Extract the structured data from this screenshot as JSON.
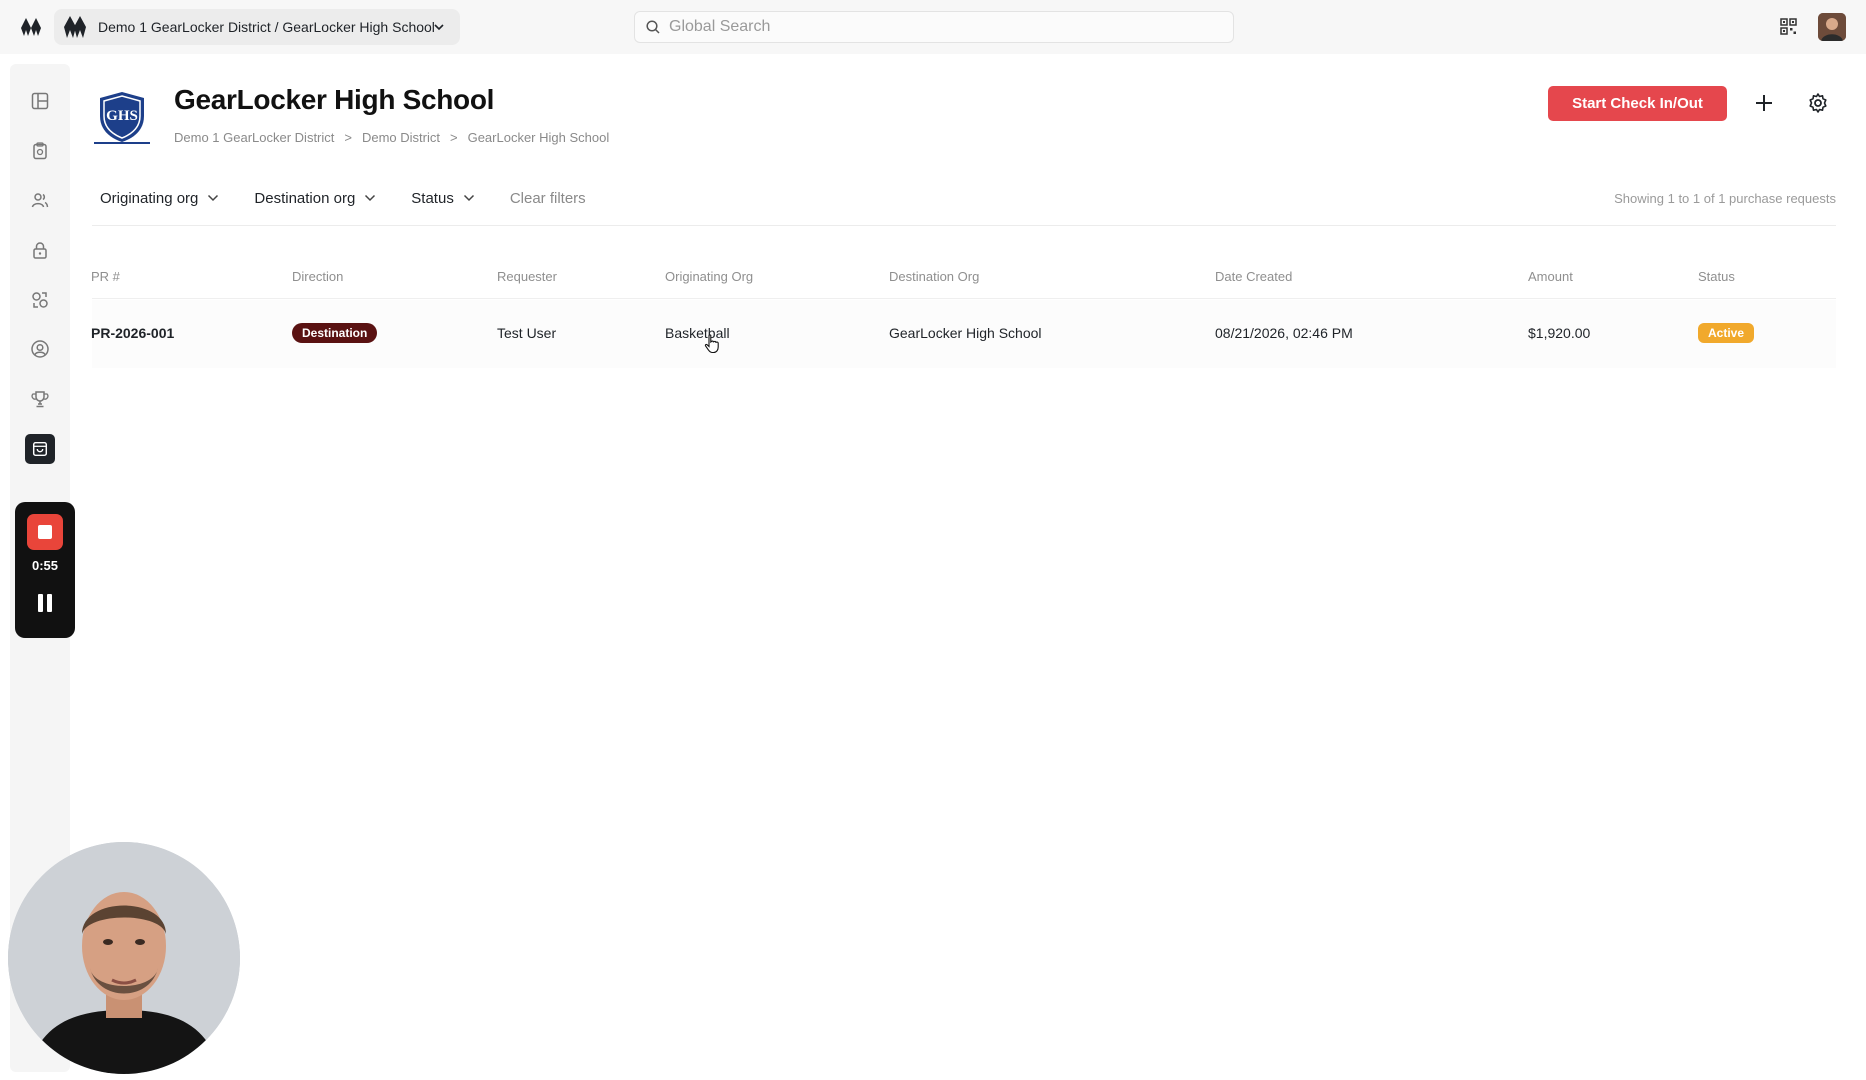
{
  "topbar": {
    "org_switcher_label": "Demo 1 GearLocker District / GearLocker High School",
    "search_placeholder": "Global Search"
  },
  "sidebar": {
    "items": [
      {
        "name": "dashboard-icon"
      },
      {
        "name": "clipboard-icon"
      },
      {
        "name": "users-icon"
      },
      {
        "name": "lock-icon"
      },
      {
        "name": "exchange-icon"
      },
      {
        "name": "user-circle-icon"
      },
      {
        "name": "trophy-icon"
      },
      {
        "name": "shopping-bag-icon",
        "active": true
      }
    ]
  },
  "recorder": {
    "time": "0:55"
  },
  "header": {
    "title": "GearLocker High School",
    "breadcrumb": [
      "Demo 1 GearLocker District",
      ">",
      "Demo District",
      ">",
      "GearLocker High School"
    ],
    "start_button": "Start Check In/Out"
  },
  "filters": {
    "items": [
      "Originating org",
      "Destination org",
      "Status"
    ],
    "clear": "Clear filters",
    "showing": "Showing 1 to 1 of 1 purchase requests"
  },
  "table": {
    "columns": [
      "PR #",
      "Direction",
      "Requester",
      "Originating Org",
      "Destination Org",
      "Date Created",
      "Amount",
      "Status"
    ],
    "rows": [
      {
        "pr": "PR-2026-001",
        "direction": "Destination",
        "requester": "Test User",
        "originating_org": "Basketball",
        "destination_org": "GearLocker High School",
        "date_created": "08/21/2026, 02:46 PM",
        "amount": "$1,920.00",
        "status": "Active"
      }
    ]
  },
  "colors": {
    "accent": "#e5474d",
    "direction_badge": "#5a1212",
    "status_active": "#f1a92c",
    "dark": "#1f2328"
  }
}
